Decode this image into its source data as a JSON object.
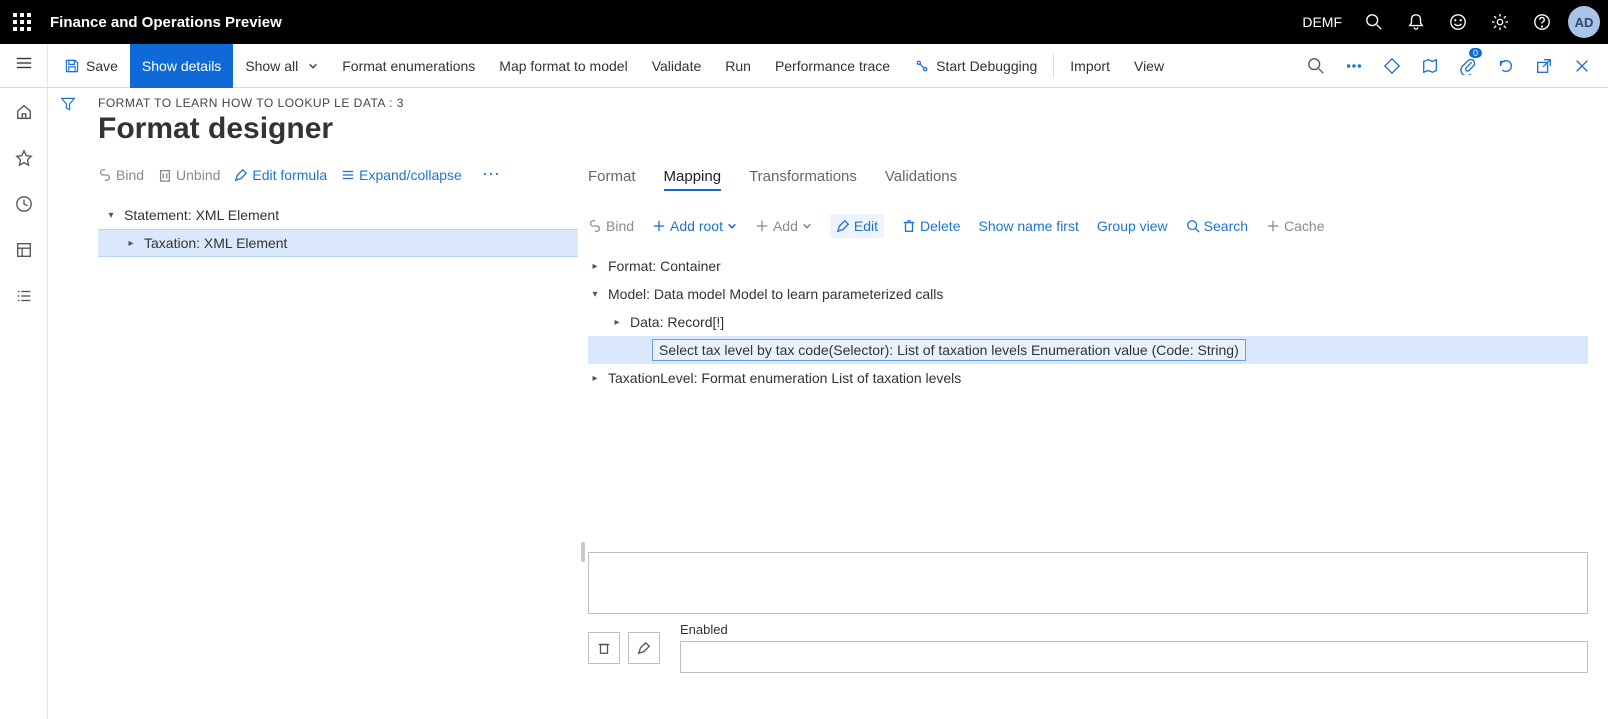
{
  "header": {
    "app_title": "Finance and Operations Preview",
    "company": "DEMF",
    "avatar": "AD"
  },
  "commandbar": {
    "save": "Save",
    "show_details": "Show details",
    "show_all": "Show all",
    "format_enum": "Format enumerations",
    "map_format": "Map format to model",
    "validate": "Validate",
    "run": "Run",
    "perf_trace": "Performance trace",
    "start_debug": "Start Debugging",
    "import": "Import",
    "view": "View",
    "attachments_badge": "0"
  },
  "page": {
    "breadcrumb": "FORMAT TO LEARN HOW TO LOOKUP LE DATA : 3",
    "title": "Format designer"
  },
  "left_toolbar": {
    "bind": "Bind",
    "unbind": "Unbind",
    "edit_formula": "Edit formula",
    "expand_collapse": "Expand/collapse"
  },
  "format_tree": {
    "root": "Statement: XML Element",
    "child": "Taxation: XML Element"
  },
  "tabs": {
    "format": "Format",
    "mapping": "Mapping",
    "transformations": "Transformations",
    "validations": "Validations",
    "active": "mapping"
  },
  "right_toolbar": {
    "bind": "Bind",
    "add_root": "Add root",
    "add": "Add",
    "edit": "Edit",
    "delete": "Delete",
    "show_name_first": "Show name first",
    "group_view": "Group view",
    "search": "Search",
    "cache": "Cache"
  },
  "ds_tree": {
    "format_container": "Format: Container",
    "model": "Model: Data model Model to learn parameterized calls",
    "data_record": "Data: Record[!]",
    "selector": "Select tax level by tax code(Selector): List of taxation levels Enumeration value (Code: String)",
    "taxation_level": "TaxationLevel: Format enumeration List of taxation levels"
  },
  "footer": {
    "enabled_label": "Enabled"
  }
}
